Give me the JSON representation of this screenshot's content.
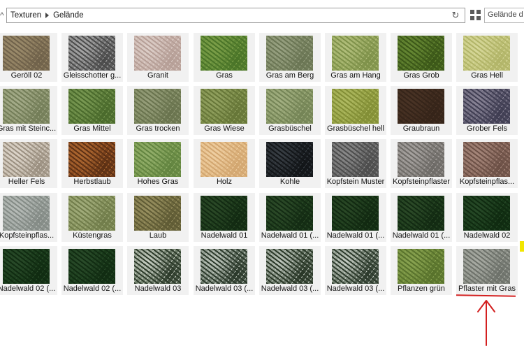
{
  "toolbar": {
    "up_icon": "chevron-up-icon",
    "breadcrumb": [
      "Texturen",
      "Gelände"
    ],
    "refresh_icon": "refresh-icon",
    "view_icon": "grid-view-icon",
    "search_placeholder": "Gelände d"
  },
  "tiles": [
    {
      "label": "Geröll 02",
      "colors": [
        "#8a7a5c",
        "#6f614a",
        "#9c8c6c"
      ]
    },
    {
      "label": "Gleisschotter g...",
      "colors": [
        "#7b7b7b",
        "#4a4a4a",
        "#a9a9a9"
      ]
    },
    {
      "label": "Granit",
      "colors": [
        "#c9b3ab",
        "#b59e96",
        "#ded0ca"
      ]
    },
    {
      "label": "Gras",
      "colors": [
        "#5f8a36",
        "#4a7428",
        "#7ea04a"
      ]
    },
    {
      "label": "Gras am Berg",
      "colors": [
        "#7f8a66",
        "#6a7554",
        "#9aa384"
      ]
    },
    {
      "label": "Gras am Hang",
      "colors": [
        "#97a85e",
        "#7e914a",
        "#b2bf7c"
      ]
    },
    {
      "label": "Gras Grob",
      "colors": [
        "#4f6e24",
        "#3b5718",
        "#688a35"
      ]
    },
    {
      "label": "Gras Hell",
      "colors": [
        "#c5c77e",
        "#b1b468",
        "#d7d89a"
      ]
    },
    {
      "label": "Gras mit Steinc...",
      "colors": [
        "#8d9670",
        "#737d58",
        "#a6ad8b"
      ]
    },
    {
      "label": "Gras Mittel",
      "colors": [
        "#5f7f3c",
        "#4a6a2c",
        "#7a9a54"
      ]
    },
    {
      "label": "Gras trocken",
      "colors": [
        "#7d8860",
        "#69734e",
        "#979f7b"
      ]
    },
    {
      "label": "Gras Wiese",
      "colors": [
        "#7b8c48",
        "#667638",
        "#94a362"
      ]
    },
    {
      "label": "Grasbüschel",
      "colors": [
        "#8a9a68",
        "#748456",
        "#a3b082"
      ]
    },
    {
      "label": "Grasbüschel hell",
      "colors": [
        "#98a446",
        "#828e36",
        "#afba62"
      ]
    },
    {
      "label": "Graubraun",
      "colors": [
        "#3f2b1e",
        "#352419",
        "#4a3426"
      ]
    },
    {
      "label": "Grober Fels",
      "colors": [
        "#5d5a6e",
        "#3f3d52",
        "#8b8698"
      ]
    },
    {
      "label": "Heller Fels",
      "colors": [
        "#c6bcae",
        "#9a8f80",
        "#ddd5ca"
      ]
    },
    {
      "label": "Herbstlaub",
      "colors": [
        "#8a4a20",
        "#5c3014",
        "#b06a32"
      ]
    },
    {
      "label": "Hohes Gras",
      "colors": [
        "#7a9a50",
        "#628440",
        "#94b06c"
      ]
    },
    {
      "label": "Holz",
      "colors": [
        "#e3bb86",
        "#d2a670",
        "#efcfa2"
      ]
    },
    {
      "label": "Kohle",
      "colors": [
        "#1e2226",
        "#121518",
        "#3a4046"
      ]
    },
    {
      "label": "Kopfstein Muster",
      "colors": [
        "#6a6a6a",
        "#4c4c4c",
        "#8a8a8a"
      ]
    },
    {
      "label": "Kopfsteinpflaster",
      "colors": [
        "#8a8682",
        "#6d6a66",
        "#a7a3a0"
      ]
    },
    {
      "label": "Kopfsteinpflas...",
      "colors": [
        "#8a6a5e",
        "#6c5046",
        "#a6877b"
      ]
    },
    {
      "label": "Kopfsteinpflas...",
      "colors": [
        "#9ea5a0",
        "#838a85",
        "#b8bdb9"
      ]
    },
    {
      "label": "Küstengras",
      "colors": [
        "#8a9660",
        "#707c4a",
        "#a3ae7d"
      ]
    },
    {
      "label": "Laub",
      "colors": [
        "#7a7446",
        "#5e5a34",
        "#9a9262"
      ]
    },
    {
      "label": "Nadelwald 01",
      "colors": [
        "#1c3a1a",
        "#122a12",
        "#2c4a28"
      ]
    },
    {
      "label": "Nadelwald 01 (...",
      "colors": [
        "#1e3c1c",
        "#132b13",
        "#2e4c2a"
      ]
    },
    {
      "label": "Nadelwald 01 (...",
      "colors": [
        "#1b391a",
        "#112911",
        "#2b4927"
      ]
    },
    {
      "label": "Nadelwald 01 (...",
      "colors": [
        "#1d3b1b",
        "#122a12",
        "#2d4b29"
      ]
    },
    {
      "label": "Nadelwald 02",
      "colors": [
        "#183a1a",
        "#0f2a10",
        "#284a28"
      ]
    },
    {
      "label": "Nadelwald 02 (...",
      "colors": [
        "#193b1a",
        "#102b11",
        "#2a4b2a"
      ]
    },
    {
      "label": "Nadelwald 02 (...",
      "colors": [
        "#1a3c1b",
        "#112c12",
        "#2b4c2b"
      ]
    },
    {
      "label": "Nadelwald 03",
      "colors": [
        "#6f7e6a",
        "#2c3a2a",
        "#c9d0c4"
      ]
    },
    {
      "label": "Nadelwald 03 (...",
      "colors": [
        "#6a786a",
        "#2a382a",
        "#c2cac0"
      ]
    },
    {
      "label": "Nadelwald 03 (...",
      "colors": [
        "#687666",
        "#283626",
        "#c0c8be"
      ]
    },
    {
      "label": "Nadelwald 03 (...",
      "colors": [
        "#6c7a6a",
        "#2b392b",
        "#c5ccc3"
      ]
    },
    {
      "label": "Pflanzen grün",
      "colors": [
        "#6f8a3a",
        "#58722c",
        "#8aa452"
      ]
    },
    {
      "label": "Pflaster mit Gras",
      "colors": [
        "#8c9088",
        "#6d716a",
        "#a9aca4"
      ]
    }
  ],
  "annotation": {
    "color": "#d32020",
    "highlighted_tile": "Pflaster mit Gras"
  }
}
